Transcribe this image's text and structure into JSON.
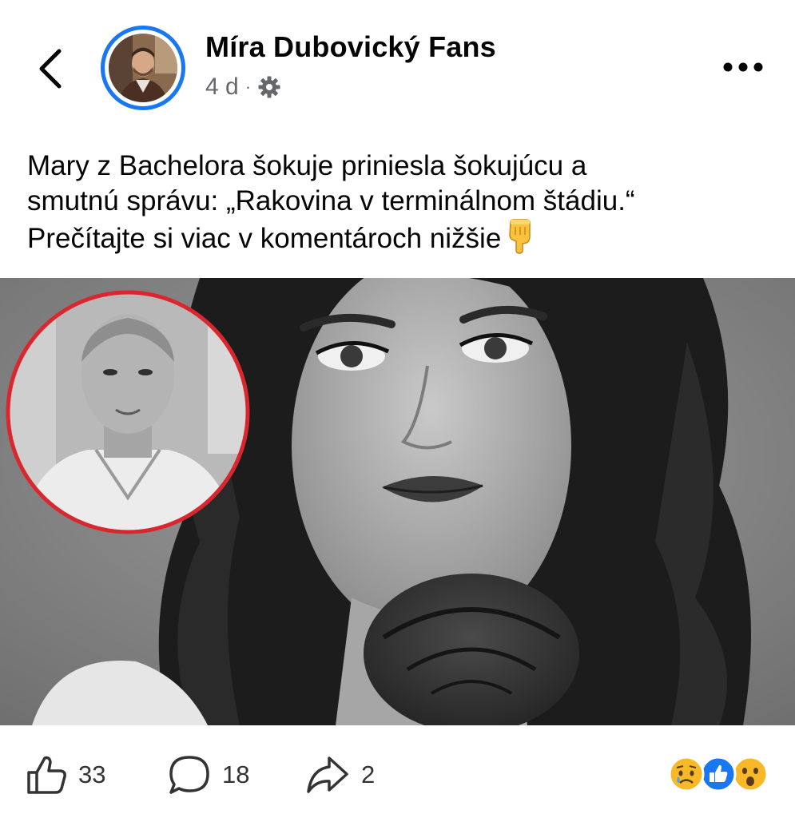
{
  "header": {
    "page_name": "Míra Dubovický Fans",
    "time": "4 d",
    "separator": "·",
    "back_icon": "chevron-left-icon",
    "privacy_icon": "gear-icon",
    "more_icon": "ellipsis-icon"
  },
  "post": {
    "lines": [
      "Mary z Bachelora šokuje priniesla šokujúcu a",
      "smutnú správu: „Rakovina v terminálnom štádiu.“",
      "Prečítajte si viac v komentároch nižšie"
    ],
    "trailing_emoji": "pointing-down-icon"
  },
  "actions": {
    "likes": "33",
    "comments": "18",
    "shares": "2",
    "reactions": [
      "sad-reaction-icon",
      "like-reaction-icon",
      "wow-reaction-icon"
    ]
  },
  "colors": {
    "brand_blue": "#1877f2",
    "text": "#050505",
    "muted": "#65676b",
    "inset_ring": "#d9262f"
  }
}
